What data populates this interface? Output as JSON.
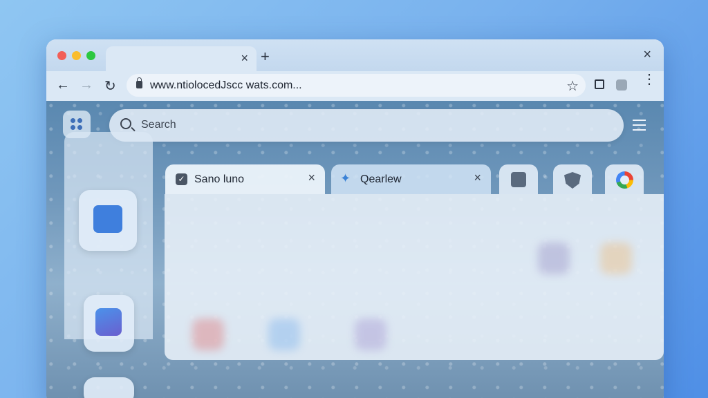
{
  "browser": {
    "newtab_symbol": "+",
    "active_tab_close": "×",
    "window_close": "×"
  },
  "toolbar": {
    "back": "←",
    "forward": "→",
    "reload": "↻",
    "url": "www.ntiolocedJscc wats.com...",
    "bookmark": "☆",
    "menu": "⋮"
  },
  "page": {
    "search_placeholder": "Search",
    "tabs": [
      {
        "label": "Sano luno",
        "icon": "check-icon",
        "close": "×"
      },
      {
        "label": "Qearlew",
        "icon": "sparkle-icon",
        "close": "×"
      },
      {
        "icon": "doc-icon"
      },
      {
        "icon": "shield-icon"
      },
      {
        "icon": "google-icon"
      }
    ],
    "side_apps": [
      "chat-icon",
      "cup-icon",
      "app-icon"
    ]
  },
  "colors": {
    "accent": "#3f7fdd",
    "red": "#f25f57",
    "yellow": "#f9bd2e",
    "green": "#2bc840"
  }
}
